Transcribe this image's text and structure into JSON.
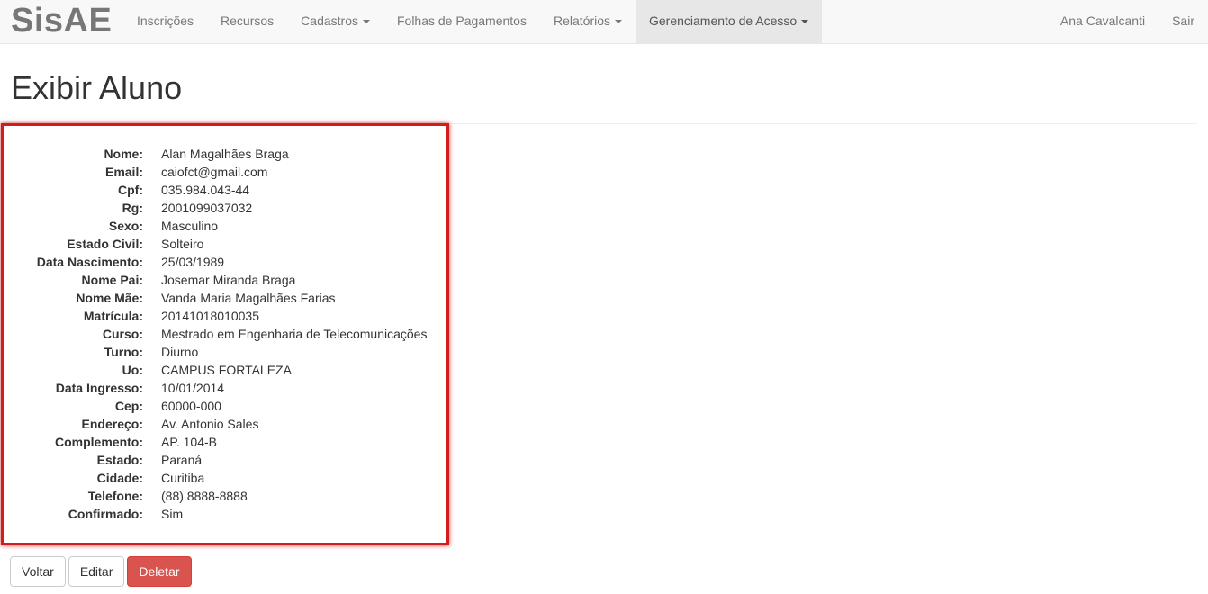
{
  "navbar": {
    "brand": "SisAE",
    "left_items": [
      {
        "label": "Inscrições",
        "dropdown": false
      },
      {
        "label": "Recursos",
        "dropdown": false
      },
      {
        "label": "Cadastros",
        "dropdown": true
      },
      {
        "label": "Folhas de Pagamentos",
        "dropdown": false
      },
      {
        "label": "Relatórios",
        "dropdown": true
      },
      {
        "label": "Gerenciamento de Acesso",
        "dropdown": true,
        "active": true
      }
    ],
    "right_items": [
      {
        "label": "Ana Cavalcanti"
      },
      {
        "label": "Sair"
      }
    ]
  },
  "page": {
    "title": "Exibir Aluno"
  },
  "details": [
    {
      "label": "Nome:",
      "value": "Alan Magalhães Braga"
    },
    {
      "label": "Email:",
      "value": "caiofct@gmail.com"
    },
    {
      "label": "Cpf:",
      "value": "035.984.043-44"
    },
    {
      "label": "Rg:",
      "value": "2001099037032"
    },
    {
      "label": "Sexo:",
      "value": "Masculino"
    },
    {
      "label": "Estado Civil:",
      "value": "Solteiro"
    },
    {
      "label": "Data Nascimento:",
      "value": "25/03/1989"
    },
    {
      "label": "Nome Pai:",
      "value": "Josemar Miranda Braga"
    },
    {
      "label": "Nome Mãe:",
      "value": "Vanda Maria Magalhães Farias"
    },
    {
      "label": "Matrícula:",
      "value": "20141018010035"
    },
    {
      "label": "Curso:",
      "value": "Mestrado em Engenharia de Telecomunicações"
    },
    {
      "label": "Turno:",
      "value": "Diurno"
    },
    {
      "label": "Uo:",
      "value": "CAMPUS FORTALEZA"
    },
    {
      "label": "Data Ingresso:",
      "value": "10/01/2014"
    },
    {
      "label": "Cep:",
      "value": "60000-000"
    },
    {
      "label": "Endereço:",
      "value": "Av. Antonio Sales"
    },
    {
      "label": "Complemento:",
      "value": "AP. 104-B"
    },
    {
      "label": "Estado:",
      "value": "Paraná"
    },
    {
      "label": "Cidade:",
      "value": "Curitiba"
    },
    {
      "label": "Telefone:",
      "value": "(88) 8888-8888"
    },
    {
      "label": "Confirmado:",
      "value": "Sim"
    }
  ],
  "buttons": {
    "back": "Voltar",
    "edit": "Editar",
    "delete": "Deletar"
  },
  "colors": {
    "highlight_border": "#d41c1c",
    "danger": "#d9534f",
    "navbar_bg": "#f8f8f8",
    "navbar_active_bg": "#e7e7e7"
  }
}
